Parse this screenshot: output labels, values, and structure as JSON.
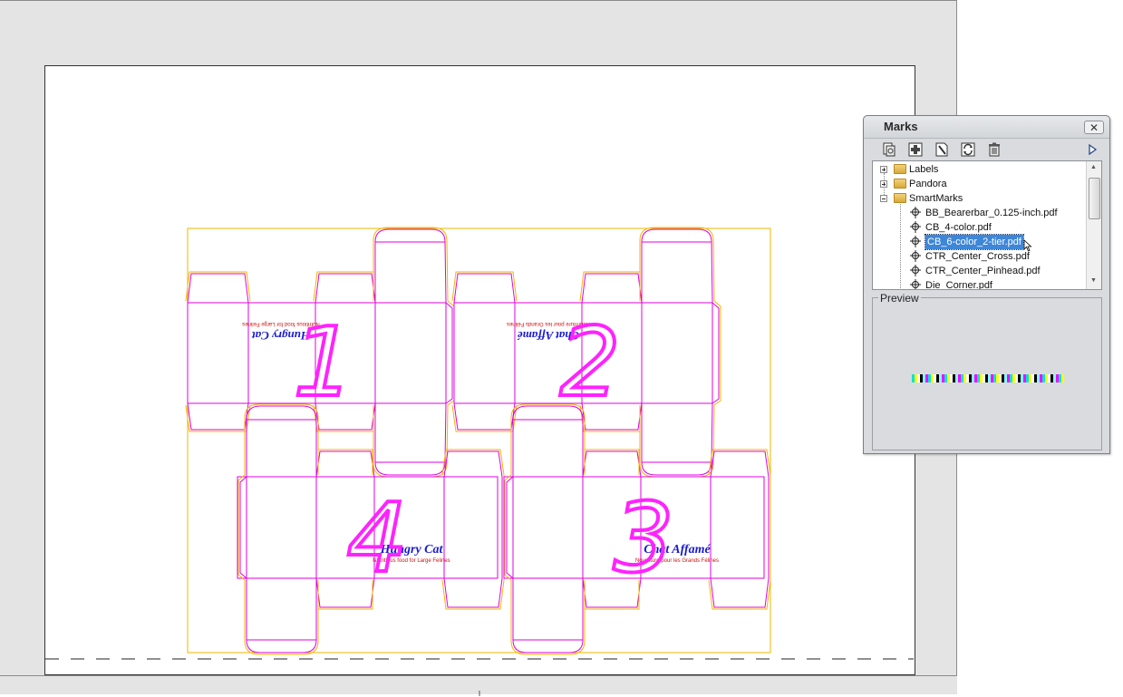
{
  "marks_panel": {
    "title": "Marks",
    "close_glyph": "✕",
    "toolbar_icons": [
      "copy-mark-icon",
      "add-mark-icon",
      "edit-mark-icon",
      "refresh-icon",
      "trash-icon",
      "play-icon"
    ],
    "tree": {
      "folders": [
        "Labels",
        "Pandora",
        "SmartMarks"
      ],
      "items": [
        "BB_Bearerbar_0.125-inch.pdf",
        "CB_4-color.pdf",
        "CB_6-color_2-tier.pdf",
        "CTR_Center_Cross.pdf",
        "CTR_Center_Pinhead.pdf",
        "Die_Corner.pdf"
      ],
      "selected_item": "CB_6-color_2-tier.pdf"
    },
    "preview_label": "Preview",
    "preview_swatch_colors": [
      "#00e0e0",
      "#ff00ff",
      "#ffff00",
      "#000000",
      "#ffffff",
      "#7fffff"
    ]
  },
  "layout": {
    "box_numbers": [
      "1",
      "2",
      "3",
      "4"
    ],
    "box_brand_texts": {
      "box1": {
        "title": "Hungry Cat",
        "subtitle": "Nutritious food for Large Felines"
      },
      "box2": {
        "title": "Chat Affamé",
        "subtitle": "Nourriture pour les Grands Félines"
      },
      "box3": {
        "title": "Chat Affamé",
        "subtitle": "Nourriture pour les Grands Félines"
      },
      "box4": {
        "title": "Hungry Cat",
        "subtitle": "Nutritious food for Large Felines"
      }
    },
    "colors": {
      "dieline": "#e000e0",
      "bleed": "#f2b700",
      "number": "#ff22ff",
      "title": "#1a1ad0",
      "subtitle": "#d01010"
    }
  }
}
